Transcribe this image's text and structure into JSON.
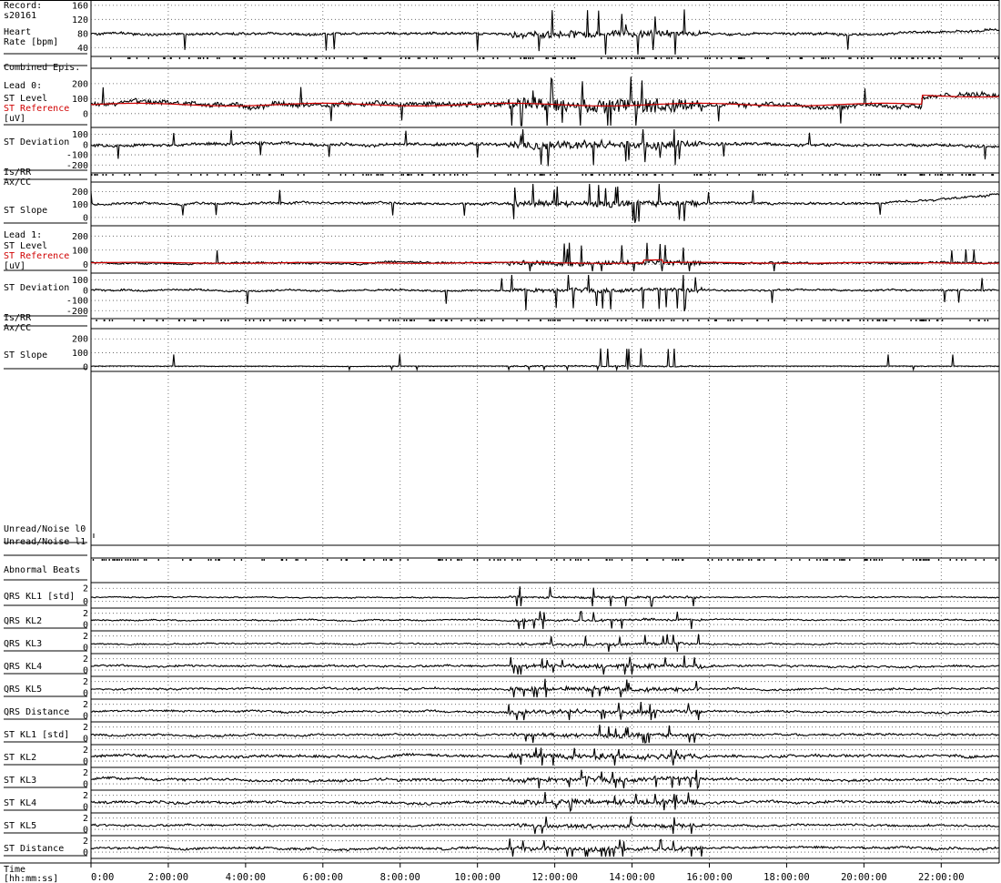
{
  "record": {
    "label": "Record:",
    "id": "s20161"
  },
  "colors": {
    "trace": "#000000",
    "reference": "#d00000",
    "grid": "#555555"
  },
  "chart_data": {
    "type": "line",
    "title": "",
    "xlabel": "Time [hh:mm:ss]",
    "x_range_hours": [
      0,
      23.5
    ],
    "x_ticks": [
      "0:00",
      "2:00:00",
      "4:00:00",
      "6:00:00",
      "8:00:00",
      "10:00:00",
      "12:00:00",
      "14:00:00",
      "16:00:00",
      "18:00:00",
      "20:00:00",
      "22:00:00"
    ],
    "tracks": [
      {
        "id": "hr",
        "labels": [
          "Heart",
          "Rate [bpm]"
        ],
        "ticks": [
          "160",
          "120",
          "80",
          "40"
        ],
        "tick_values": [
          160,
          120,
          80,
          40
        ],
        "ylim": [
          20,
          170
        ],
        "kind": "line",
        "base": 80,
        "amp": 6
      },
      {
        "id": "combined",
        "labels": [
          "Combined Epis."
        ],
        "ticks": [],
        "kind": "events"
      },
      {
        "id": "l0_level",
        "labels": [
          "Lead 0:",
          "ST Level",
          "ST Reference",
          "[uV]"
        ],
        "red_label_index": 2,
        "ticks": [
          "200",
          "100",
          "0"
        ],
        "tick_values": [
          200,
          100,
          0
        ],
        "ylim": [
          -80,
          290
        ],
        "kind": "line_ref",
        "base": 60,
        "amp": 30
      },
      {
        "id": "l0_dev",
        "labels": [
          "ST Deviation"
        ],
        "ticks": [
          "100",
          "0",
          "-100",
          "-200"
        ],
        "tick_values": [
          100,
          0,
          -100,
          -200
        ],
        "ylim": [
          -260,
          150
        ],
        "kind": "line",
        "base": 0,
        "amp": 25
      },
      {
        "id": "l0_isrr",
        "labels": [
          "Is/RR",
          "Ax/CC"
        ],
        "ticks": [],
        "kind": "events"
      },
      {
        "id": "l0_slope",
        "labels": [
          "ST Slope"
        ],
        "ticks": [
          "200",
          "100",
          "0"
        ],
        "tick_values": [
          200,
          100,
          0
        ],
        "ylim": [
          -50,
          260
        ],
        "kind": "line",
        "base": 110,
        "amp": 15
      },
      {
        "id": "l1_level",
        "labels": [
          "Lead 1:",
          "ST Level",
          "ST Reference",
          "[uV]"
        ],
        "red_label_index": 2,
        "ticks": [
          "200",
          "100",
          "0"
        ],
        "tick_values": [
          200,
          100,
          0
        ],
        "ylim": [
          -50,
          260
        ],
        "kind": "line_ref",
        "base": 10,
        "amp": 12
      },
      {
        "id": "l1_dev",
        "labels": [
          "ST Deviation"
        ],
        "ticks": [
          "100",
          "0",
          "-100",
          "-200"
        ],
        "tick_values": [
          100,
          0,
          -100,
          -200
        ],
        "ylim": [
          -260,
          150
        ],
        "kind": "line",
        "base": 0,
        "amp": 15
      },
      {
        "id": "l1_isrr",
        "labels": [
          "Is/RR",
          "Ax/CC"
        ],
        "ticks": [],
        "kind": "events"
      },
      {
        "id": "l1_slope",
        "labels": [
          "ST Slope"
        ],
        "ticks": [
          "200",
          "100",
          "0"
        ],
        "tick_values": [
          200,
          100,
          0
        ],
        "ylim": [
          -20,
          260
        ],
        "kind": "line",
        "base": 5,
        "amp": 3
      },
      {
        "id": "noise0",
        "labels": [
          "Unread/Noise l0"
        ],
        "ticks": [],
        "kind": "empty"
      },
      {
        "id": "noise1",
        "labels": [
          "Unread/Noise l1"
        ],
        "ticks": [],
        "kind": "empty"
      },
      {
        "id": "abnormal",
        "labels": [
          "Abnormal Beats"
        ],
        "ticks": [],
        "kind": "events"
      },
      {
        "id": "qrs_kl1",
        "labels": [
          "QRS KL1 [std]"
        ],
        "ticks": [
          "2",
          "0"
        ],
        "tick_values": [
          2,
          0
        ],
        "ylim": [
          -0.8,
          2.6
        ],
        "kind": "kl",
        "base": 0.6,
        "amp": 0.15
      },
      {
        "id": "qrs_kl2",
        "labels": [
          "QRS KL2"
        ],
        "ticks": [
          "2",
          "0"
        ],
        "tick_values": [
          2,
          0
        ],
        "ylim": [
          -0.8,
          2.6
        ],
        "kind": "kl",
        "base": 0.8,
        "amp": 0.2
      },
      {
        "id": "qrs_kl3",
        "labels": [
          "QRS KL3"
        ],
        "ticks": [
          "2",
          "0"
        ],
        "tick_values": [
          2,
          0
        ],
        "ylim": [
          -0.8,
          2.6
        ],
        "kind": "kl",
        "base": 0.6,
        "amp": 0.2
      },
      {
        "id": "qrs_kl4",
        "labels": [
          "QRS KL4"
        ],
        "ticks": [
          "2",
          "0"
        ],
        "tick_values": [
          2,
          0
        ],
        "ylim": [
          -0.8,
          2.6
        ],
        "kind": "kl",
        "base": 0.7,
        "amp": 0.3
      },
      {
        "id": "qrs_kl5",
        "labels": [
          "QRS KL5"
        ],
        "ticks": [
          "2",
          "0"
        ],
        "tick_values": [
          2,
          0
        ],
        "ylim": [
          -0.8,
          2.6
        ],
        "kind": "kl",
        "base": 0.7,
        "amp": 0.3
      },
      {
        "id": "qrs_dist",
        "labels": [
          "QRS Distance"
        ],
        "ticks": [
          "2",
          "0"
        ],
        "tick_values": [
          2,
          0
        ],
        "ylim": [
          -0.8,
          2.6
        ],
        "kind": "kl",
        "base": 0.7,
        "amp": 0.3
      },
      {
        "id": "st_kl1",
        "labels": [
          "ST KL1 [std]"
        ],
        "ticks": [
          "2",
          "0"
        ],
        "tick_values": [
          2,
          0
        ],
        "ylim": [
          -0.8,
          2.6
        ],
        "kind": "kl",
        "base": 0.6,
        "amp": 0.3
      },
      {
        "id": "st_kl2",
        "labels": [
          "ST KL2"
        ],
        "ticks": [
          "2",
          "0"
        ],
        "tick_values": [
          2,
          0
        ],
        "ylim": [
          -0.8,
          2.6
        ],
        "kind": "kl",
        "base": 0.9,
        "amp": 0.4
      },
      {
        "id": "st_kl3",
        "labels": [
          "ST KL3"
        ],
        "ticks": [
          "2",
          "0"
        ],
        "tick_values": [
          2,
          0
        ],
        "ylim": [
          -0.8,
          2.6
        ],
        "kind": "kl",
        "base": 0.8,
        "amp": 0.4
      },
      {
        "id": "st_kl4",
        "labels": [
          "ST KL4"
        ],
        "ticks": [
          "2",
          "0"
        ],
        "tick_values": [
          2,
          0
        ],
        "ylim": [
          -0.8,
          2.6
        ],
        "kind": "kl",
        "base": 0.8,
        "amp": 0.4
      },
      {
        "id": "st_kl5",
        "labels": [
          "ST KL5"
        ],
        "ticks": [
          "2",
          "0"
        ],
        "tick_values": [
          2,
          0
        ],
        "ylim": [
          -0.8,
          2.6
        ],
        "kind": "kl",
        "base": 0.7,
        "amp": 0.3
      },
      {
        "id": "st_dist",
        "labels": [
          "ST Distance"
        ],
        "ticks": [
          "2",
          "0"
        ],
        "tick_values": [
          2,
          0
        ],
        "ylim": [
          -0.8,
          2.6
        ],
        "kind": "kl",
        "base": 0.7,
        "amp": 0.35
      }
    ],
    "grid": true,
    "legend": "none"
  }
}
